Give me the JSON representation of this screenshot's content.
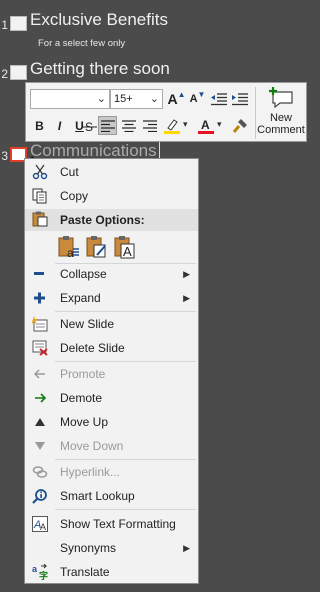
{
  "slides": [
    {
      "number": "1",
      "title": "Exclusive Benefits",
      "subtitle": "For a select few only"
    },
    {
      "number": "2",
      "title": "Getting there soon"
    },
    {
      "number": "3",
      "title": "Communications"
    }
  ],
  "toolbar": {
    "font_name": "",
    "font_size": "15+",
    "grow_font": "A",
    "shrink_font": "A",
    "bold": "B",
    "italic": "I",
    "underline": "U",
    "new_comment_line1": "New",
    "new_comment_line2": "Comment"
  },
  "context_menu": {
    "cut": "Cut",
    "copy": "Copy",
    "paste_options": "Paste Options:",
    "collapse": "Collapse",
    "expand": "Expand",
    "new_slide": "New Slide",
    "delete_slide": "Delete Slide",
    "promote": "Promote",
    "demote": "Demote",
    "move_up": "Move Up",
    "move_down": "Move Down",
    "hyperlink": "Hyperlink...",
    "smart_lookup": "Smart Lookup",
    "show_text_formatting": "Show Text Formatting",
    "synonyms": "Synonyms",
    "translate": "Translate"
  },
  "colors": {
    "background": "#4b4b4b",
    "menu_bg": "#f2f2f2",
    "icon_blue": "#1e4e8c",
    "highlight_yellow": "#ffd800",
    "font_red": "#e81123",
    "comment_green": "#107c10"
  }
}
